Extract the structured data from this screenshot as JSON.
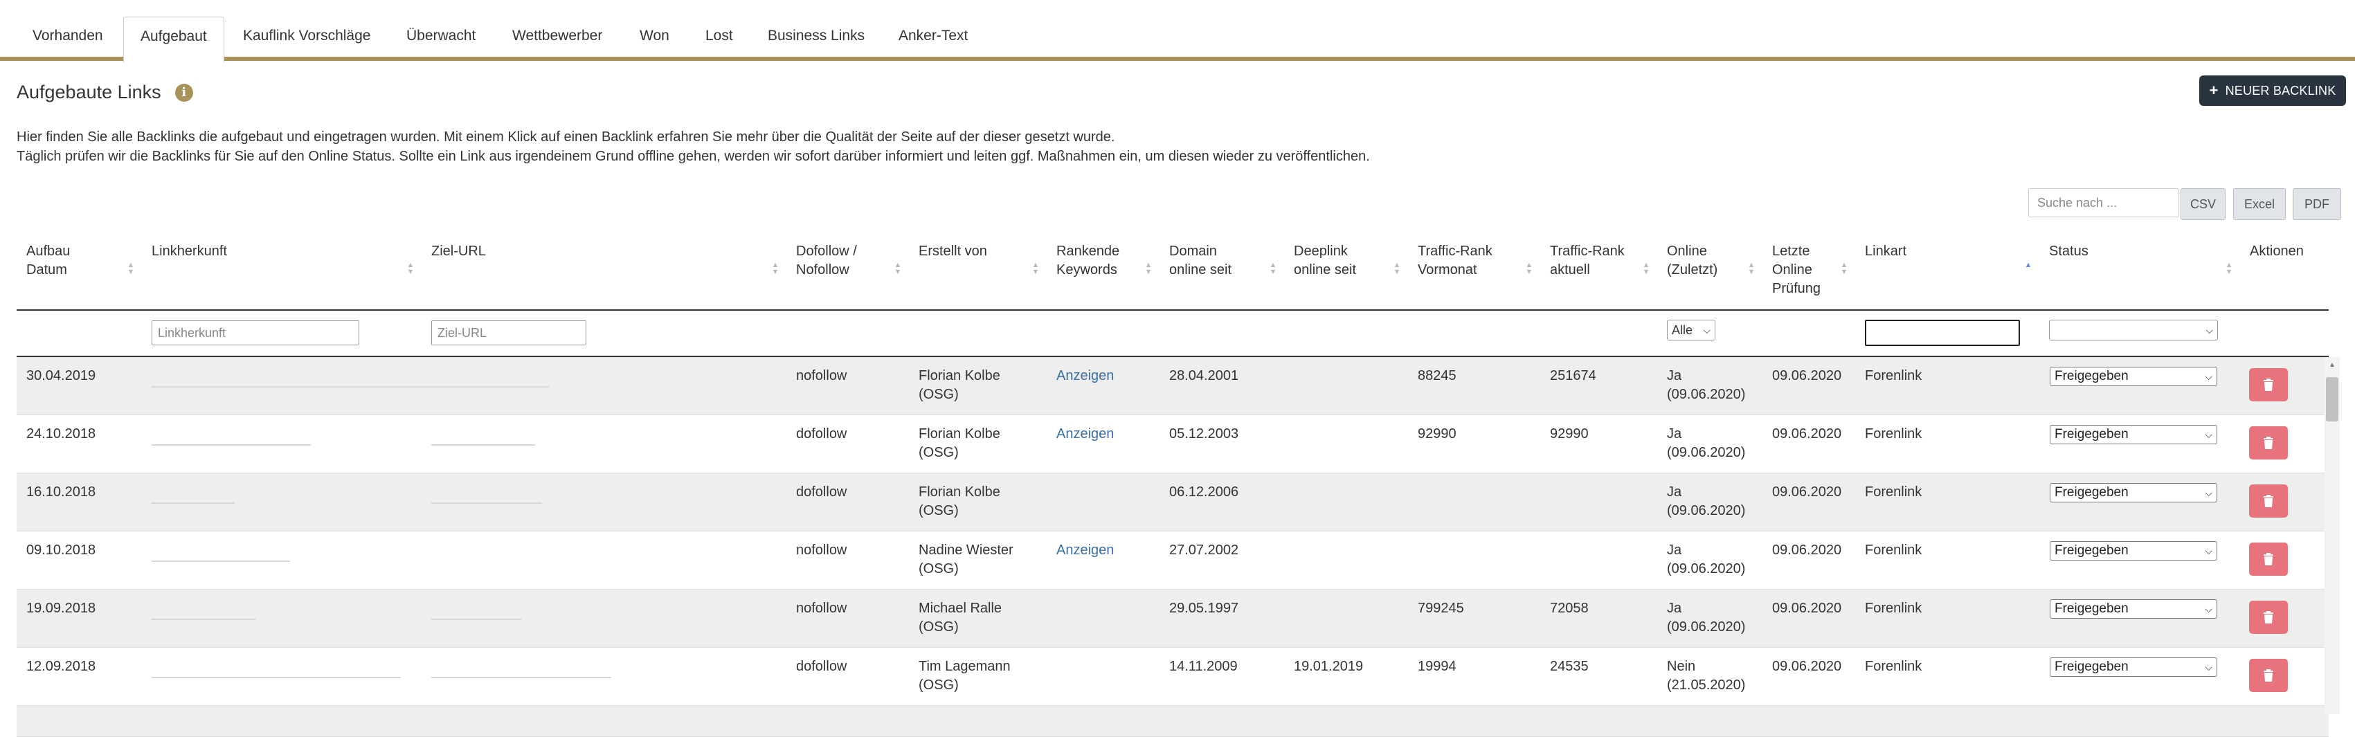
{
  "tabs": [
    "Vorhanden",
    "Aufgebaut",
    "Kauflink Vorschläge",
    "Überwacht",
    "Wettbewerber",
    "Won",
    "Lost",
    "Business Links",
    "Anker-Text"
  ],
  "active_tab": "Aufgebaut",
  "page": {
    "title": "Aufgebaute Links",
    "new_button": "NEUER BACKLINK",
    "desc1": "Hier finden Sie alle Backlinks die aufgebaut und eingetragen wurden. Mit einem Klick auf einen Backlink erfahren Sie mehr über die Qualität der Seite auf der dieser gesetzt wurde.",
    "desc2": "Täglich prüfen wir die Backlinks für Sie auf den Online Status. Sollte ein Link aus irgendeinem Grund offline gehen, werden wir sofort darüber informiert und leiten ggf. Maßnahmen ein, um diesen wieder zu veröffentlichen."
  },
  "search": {
    "placeholder": "Suche nach ..."
  },
  "export": {
    "csv": "CSV",
    "excel": "Excel",
    "pdf": "PDF"
  },
  "columns": {
    "aufbau": "Aufbau\nDatum",
    "linkherkunft": "Linkherkunft",
    "ziel": "Ziel-URL",
    "dofollow": "Dofollow /\nNofollow",
    "erstellt": "Erstellt von",
    "keywords": "Rankende\nKeywords",
    "domain": "Domain\nonline seit",
    "deeplink": "Deeplink\nonline seit",
    "traffic_vor": "Traffic-Rank\nVormonat",
    "traffic_akt": "Traffic-Rank\naktuell",
    "online": "Online\n(Zuletzt)",
    "letzte": "Letzte\nOnline\nPrüfung",
    "linkart": "Linkart",
    "status": "Status",
    "aktionen": "Aktionen"
  },
  "filters": {
    "linkherkunft_placeholder": "Linkherkunft",
    "ziel_placeholder": "Ziel-URL",
    "online_value": "Alle"
  },
  "rows": [
    {
      "datum": "30.04.2019",
      "follow": "nofollow",
      "erstellt": "Florian Kolbe\n(OSG)",
      "keywords": "Anzeigen",
      "domain": "28.04.2001",
      "deeplink": "",
      "tvor": "88245",
      "takt": "251674",
      "online": "Ja\n(09.06.2020)",
      "letzte": "09.06.2020",
      "linkart": "Forenlink",
      "status": "Freigegeben"
    },
    {
      "datum": "24.10.2018",
      "follow": "dofollow",
      "erstellt": "Florian Kolbe\n(OSG)",
      "keywords": "Anzeigen",
      "domain": "05.12.2003",
      "deeplink": "",
      "tvor": "92990",
      "takt": "92990",
      "online": "Ja\n(09.06.2020)",
      "letzte": "09.06.2020",
      "linkart": "Forenlink",
      "status": "Freigegeben"
    },
    {
      "datum": "16.10.2018",
      "follow": "dofollow",
      "erstellt": "Florian Kolbe\n(OSG)",
      "keywords": "",
      "domain": "06.12.2006",
      "deeplink": "",
      "tvor": "",
      "takt": "",
      "online": "Ja\n(09.06.2020)",
      "letzte": "09.06.2020",
      "linkart": "Forenlink",
      "status": "Freigegeben"
    },
    {
      "datum": "09.10.2018",
      "follow": "nofollow",
      "erstellt": "Nadine Wiester\n(OSG)",
      "keywords": "Anzeigen",
      "domain": "27.07.2002",
      "deeplink": "",
      "tvor": "",
      "takt": "",
      "online": "Ja\n(09.06.2020)",
      "letzte": "09.06.2020",
      "linkart": "Forenlink",
      "status": "Freigegeben"
    },
    {
      "datum": "19.09.2018",
      "follow": "nofollow",
      "erstellt": "Michael Ralle\n(OSG)",
      "keywords": "",
      "domain": "29.05.1997",
      "deeplink": "",
      "tvor": "799245",
      "takt": "72058",
      "online": "Ja\n(09.06.2020)",
      "letzte": "09.06.2020",
      "linkart": "Forenlink",
      "status": "Freigegeben"
    },
    {
      "datum": "12.09.2018",
      "follow": "dofollow",
      "erstellt": "Tim Lagemann\n(OSG)",
      "keywords": "",
      "domain": "14.11.2009",
      "deeplink": "19.01.2019",
      "tvor": "19994",
      "takt": "24535",
      "online": "Nein\n(21.05.2020)",
      "letzte": "09.06.2020",
      "linkart": "Forenlink",
      "status": "Freigegeben"
    }
  ],
  "colors": {
    "accent": "#a8935a",
    "primary_btn": "#2a3440",
    "delete_btn": "#e8737c",
    "link": "#3a6ea5"
  }
}
